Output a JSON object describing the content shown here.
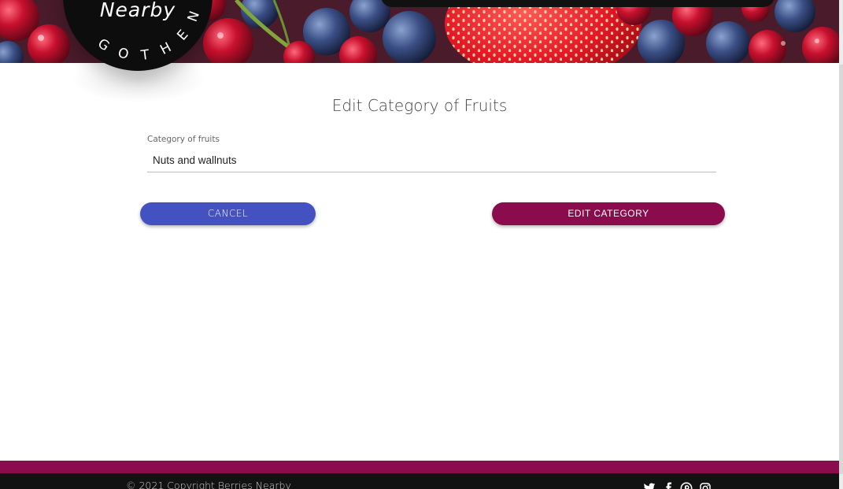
{
  "logo": {
    "word": "Nearby",
    "arc_text": "GOTHENBURG"
  },
  "form": {
    "title": "Edit Category of Fruits",
    "field_label": "Category of fruits",
    "field_value": "Nuts and wallnuts"
  },
  "buttons": {
    "cancel": "CANCEL",
    "edit": "EDIT CATEGORY"
  },
  "footer": {
    "copyright": "© 2021 Copyright Berries Nearby",
    "social_icons": [
      "twitter-icon",
      "facebook-icon",
      "pinterest-icon",
      "instagram-icon"
    ]
  },
  "colors": {
    "cancel_button": "#4352c0",
    "edit_button": "#8a0c4c",
    "footer_band": "#8a0c4c",
    "footer": "#121212"
  }
}
